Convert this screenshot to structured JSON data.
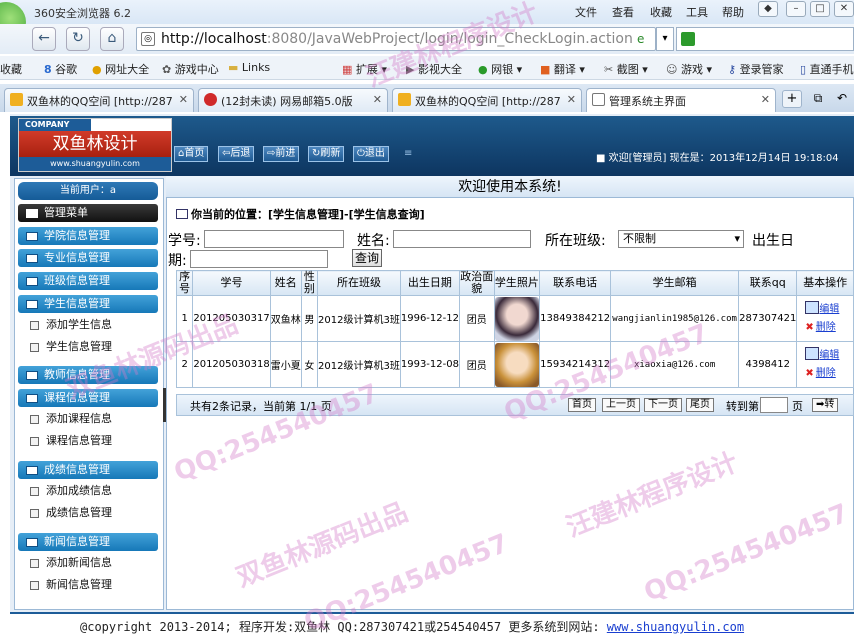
{
  "browser": {
    "title": "360安全浏览器 6.2",
    "menu": [
      "文件",
      "查看",
      "收藏",
      "工具",
      "帮助"
    ],
    "url_host": "http://localhost",
    "url_path": ":8080/JavaWebProject/login/login_CheckLogin.action",
    "bookmarks": [
      "收藏",
      "谷歌",
      "网址大全",
      "游戏中心",
      "Links",
      "扩展",
      "影视大全",
      "网银",
      "翻译",
      "截图",
      "游戏",
      "登录管家",
      "直通手机"
    ],
    "tabs": [
      {
        "label": "双鱼林的QQ空间 [http://287"
      },
      {
        "label": "(12封未读) 网易邮箱5.0版"
      },
      {
        "label": "双鱼林的QQ空间 [http://287"
      },
      {
        "label": "管理系统主界面",
        "active": true
      }
    ]
  },
  "header": {
    "logo_tag": "COMPANY",
    "logo_name": "双鱼林设计",
    "logo_site": "www.shuangyulin.com",
    "buttons": [
      "首页",
      "后退",
      "前进",
      "刷新",
      "退出"
    ],
    "welcome": "欢迎[管理员]  现在是：2013年12月14日 19:18:04"
  },
  "sidebar": {
    "current_user": "当前用户：a",
    "menu_title": "管理菜单",
    "groups": [
      {
        "title": "学院信息管理",
        "items": []
      },
      {
        "title": "专业信息管理",
        "items": []
      },
      {
        "title": "班级信息管理",
        "items": []
      },
      {
        "title": "学生信息管理",
        "items": [
          "添加学生信息",
          "学生信息管理"
        ]
      },
      {
        "title": "教师信息管理",
        "items": []
      },
      {
        "title": "课程信息管理",
        "items": [
          "添加课程信息",
          "课程信息管理"
        ]
      },
      {
        "title": "成绩信息管理",
        "items": [
          "添加成绩信息",
          "成绩信息管理"
        ]
      },
      {
        "title": "新闻信息管理",
        "items": [
          "添加新闻信息",
          "新闻信息管理"
        ]
      }
    ]
  },
  "main": {
    "heading": "欢迎使用本系统!",
    "breadcrumb": "你当前的位置：[学生信息管理]-[学生信息查询]",
    "search": {
      "student_no_label": "学号:",
      "name_label": "姓名:",
      "class_label": "所在班级:",
      "class_value": "不限制",
      "birth_label_1": "出生日",
      "birth_label_2": "期:",
      "query_button": "查询"
    },
    "table": {
      "headers": [
        "序号",
        "学号",
        "姓名",
        "性别",
        "所在班级",
        "出生日期",
        "政治面貌",
        "学生照片",
        "联系电话",
        "学生邮箱",
        "联系qq",
        "基本操作"
      ],
      "rows": [
        {
          "index": "1",
          "student_no": "201205030317",
          "name": "双鱼林",
          "gender": "男",
          "class": "2012级计算机3班",
          "birth": "1996-12-12",
          "politics": "团员",
          "phone": "13849384212",
          "email": "wangjianlin1985@126.com",
          "qq": "287307421",
          "edit": "编辑",
          "delete": "删除"
        },
        {
          "index": "2",
          "student_no": "201205030318",
          "name": "雷小夏",
          "gender": "女",
          "class": "2012级计算机3班",
          "birth": "1993-12-08",
          "politics": "团员",
          "phone": "15934214312",
          "email": "xiaoxia@126.com",
          "qq": "4398412",
          "edit": "编辑",
          "delete": "删除"
        }
      ]
    },
    "pager": {
      "info": "共有2条记录，当前第 1/1 页",
      "first": "首页",
      "prev": "上一页",
      "next": "下一页",
      "last": "尾页",
      "goto_label": "转到第",
      "page_unit": "页",
      "goto_button": "转"
    }
  },
  "footer": {
    "text": "@copyright 2013-2014; 程序开发:双鱼林  QQ:287307421或254540457  更多系统到网站: ",
    "link": "www.shuangyulin.com"
  },
  "watermarks": [
    "双鱼林源码出品",
    "汪建林程序设计",
    "QQ:254540457"
  ],
  "colors": {
    "brand_blue": "#1d5c98",
    "side_header": "#1678b8",
    "watermark": "#d278c8"
  }
}
